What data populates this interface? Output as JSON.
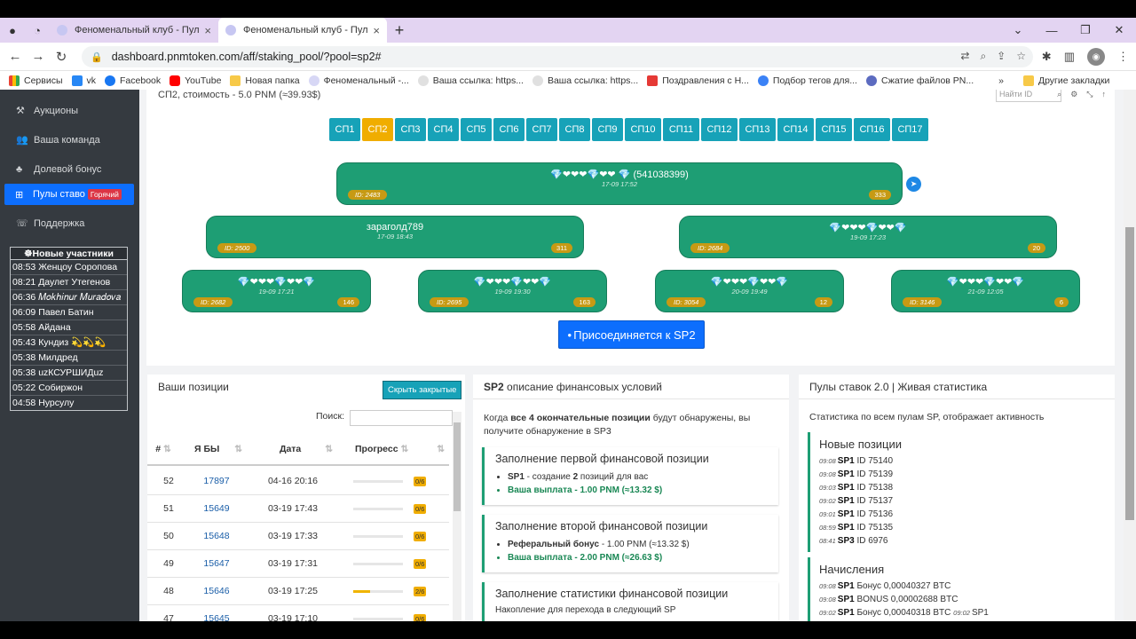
{
  "browser": {
    "tabs": [
      {
        "title": "Феноменальный клуб - Пулы ст"
      },
      {
        "title": "Феноменальный клуб - Пулы ст"
      }
    ],
    "url": "dashboard.pnmtoken.com/aff/staking_pool/?pool=sp2#",
    "bookmarks": [
      "Сервисы",
      "vk",
      "Facebook",
      "YouTube",
      "Новая папка",
      "Феноменальный -...",
      "Ваша ссылка: https...",
      "Ваша ссылка: https...",
      "Поздравления с Н...",
      "Подбор тегов для...",
      "Сжатие файлов PN...",
      "Другие закладки"
    ],
    "more": "»"
  },
  "sidebar": {
    "items": [
      {
        "label": "Аукционы",
        "icon": "gavel-icon"
      },
      {
        "label": "Ваша команда",
        "icon": "users-icon"
      },
      {
        "label": "Долевой бонус",
        "icon": "tree-icon"
      },
      {
        "label": "Пулы ставо",
        "icon": "pools-icon",
        "badge": "Горячий"
      },
      {
        "label": "Поддержка",
        "icon": "support-icon"
      }
    ],
    "members_title": "Новые участники",
    "members": [
      "08:53 Женцоу Соропова",
      "08:21 Даулет Утегенов",
      "06:36 𝑀𝑜𝑘ℎ𝑖𝑛𝑢𝑟 𝑀𝑢𝑟𝑎𝑑𝑜𝑣𝑎",
      "06:09 Павел Батин",
      "05:58 Айдана",
      "05:43 Кундиз 💫💫💫",
      "05:38 Милдред",
      "05:38 uzКСУРШИДuz",
      "05:22 Собиржон",
      "04:58 Нурсулу"
    ]
  },
  "pool": {
    "crumb": "СП2, стоимость - 5.0 PNM (≈39.93$)",
    "find_placeholder": "Найти ID",
    "tabs": [
      "СП1",
      "СП2",
      "СП3",
      "СП4",
      "СП5",
      "СП6",
      "СП7",
      "СП8",
      "СП9",
      "СП10",
      "СП11",
      "СП12",
      "СП13",
      "СП14",
      "СП15",
      "СП16",
      "СП17"
    ],
    "active_tab": "СП2",
    "root": {
      "name": "💎❤❤❤💎❤❤ 💎 (541038399)",
      "date": "17-09 17:52",
      "id": "ID: 2483",
      "count": "333"
    },
    "level2": [
      {
        "name": "зараголд789",
        "date": "17-09 18:43",
        "id": "ID: 2500",
        "count": "311"
      },
      {
        "name": "💎❤❤❤💎❤❤💎",
        "date": "19-09 17:23",
        "id": "ID: 2684",
        "count": "20"
      }
    ],
    "level3": [
      {
        "name": "💎❤❤❤💎❤❤💎",
        "date": "19-09 17:21",
        "id": "ID: 2682",
        "count": "146"
      },
      {
        "name": "💎❤❤❤💎❤❤💎",
        "date": "19-09 19:30",
        "id": "ID: 2695",
        "count": "163"
      },
      {
        "name": "💎❤❤❤💎❤❤💎",
        "date": "20-09 19:49",
        "id": "ID: 3054",
        "count": "12"
      },
      {
        "name": "💎❤❤❤💎❤❤💎",
        "date": "21-09 12:05",
        "id": "ID: 3146",
        "count": "6"
      }
    ],
    "join_label": "Присоединяется к SP2"
  },
  "positions": {
    "title": "Ваши позиции",
    "hide_label": "Скрыть закрытые",
    "search_label": "Поиск:",
    "headers": [
      "#",
      "Я БЫ",
      "Дата",
      "Прогресс"
    ],
    "rows": [
      {
        "num": "52",
        "id": "17897",
        "date": "04-16 20:16",
        "badge": "0/6",
        "progress": 0
      },
      {
        "num": "51",
        "id": "15649",
        "date": "03-19 17:43",
        "badge": "0/6",
        "progress": 0
      },
      {
        "num": "50",
        "id": "15648",
        "date": "03-19 17:33",
        "badge": "0/6",
        "progress": 0
      },
      {
        "num": "49",
        "id": "15647",
        "date": "03-19 17:31",
        "badge": "0/6",
        "progress": 0
      },
      {
        "num": "48",
        "id": "15646",
        "date": "03-19 17:25",
        "badge": "2/6",
        "progress": 0.333
      },
      {
        "num": "47",
        "id": "15645",
        "date": "03-19 17:10",
        "badge": "0/6",
        "progress": 0
      }
    ]
  },
  "finance": {
    "title_bold": "SP2",
    "title_rest": " описание финансовых условий",
    "intro_a": "Когда ",
    "intro_b": "все 4 окончательные позиции",
    "intro_c": " будут обнаружены, вы получите обнаружение в SP3",
    "box1_title": "Заполнение первой финансовой позиции",
    "box1_l1a": "SP1",
    "box1_l1b": " - создание ",
    "box1_l1c": "2",
    "box1_l1d": " позиций для вас",
    "box1_l2": "Ваша выплата - 1.00 PNM (≈13.32 $)",
    "box2_title": "Заполнение второй финансовой позиции",
    "box2_l1a": "Реферальный бонус",
    "box2_l1b": " - 1.00 PNM (≈13.32 $)",
    "box2_l2": "Ваша выплата - 2.00 PNM (≈26.63 $)",
    "box3_title": "Заполнение статистики финансовой позиции",
    "box3_l1": "Накопление для перехода в следующий SP"
  },
  "stats": {
    "title": "Пулы ставок 2.0 | Живая статистика",
    "intro": "Статистика по всем пулам SP, отображает активность",
    "new_title": "Новые позиции",
    "new_rows": [
      {
        "t": "09:08",
        "sp": "SP1",
        "rest": " ID 75140"
      },
      {
        "t": "09:08",
        "sp": "SP1",
        "rest": " ID 75139"
      },
      {
        "t": "09:03",
        "sp": "SP1",
        "rest": " ID 75138"
      },
      {
        "t": "09:02",
        "sp": "SP1",
        "rest": " ID 75137"
      },
      {
        "t": "09:01",
        "sp": "SP1",
        "rest": " ID 75136"
      },
      {
        "t": "08:59",
        "sp": "SP1",
        "rest": " ID 75135"
      },
      {
        "t": "08:41",
        "sp": "SP3",
        "rest": " ID 6976"
      }
    ],
    "acc_title": "Начисления",
    "acc_rows": [
      {
        "t": "09:08",
        "sp": "SP1",
        "rest": " Бонус 0,00040327 BTC"
      },
      {
        "t": "09:08",
        "sp": "SP1",
        "rest": " BONUS 0,00002688 BTC"
      },
      {
        "t": "09:02",
        "sp": "SP1",
        "rest": " Бонус 0,00040318 BTC",
        "t2": "09:02",
        "sp2": "SP1"
      }
    ]
  }
}
